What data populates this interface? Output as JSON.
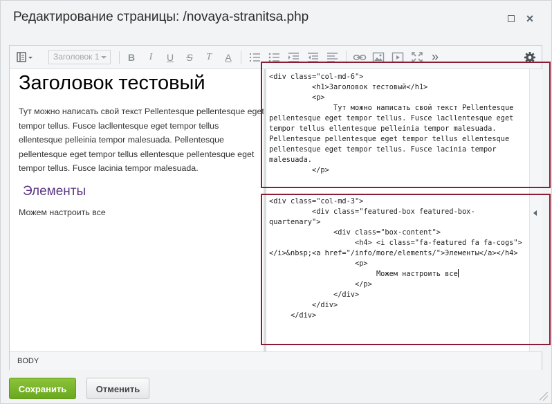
{
  "dialog": {
    "title": "Редактирование страницы: /novaya-stranitsa.php",
    "maximize_icon": "maximize-icon",
    "close_icon": "close-icon",
    "close_glyph": "×"
  },
  "toolbar": {
    "style_select_value": "Заголовок 1",
    "icons": [
      "view-mode-icon",
      "bold-icon",
      "italic-icon",
      "underline-icon",
      "strikethrough-icon",
      "clear-format-icon",
      "text-color-icon",
      "ordered-list-icon",
      "unordered-list-icon",
      "indent-icon",
      "outdent-icon",
      "align-icon",
      "link-icon",
      "image-icon",
      "video-icon",
      "fullscreen-icon",
      "more-icon",
      "settings-icon"
    ],
    "glyphs": {
      "bold": "B",
      "italic": "I",
      "underline": "U",
      "strike": "S",
      "clear": "T",
      "color": "A",
      "more": "»"
    }
  },
  "content": {
    "heading": "Заголовок тестовый",
    "paragraph": "Тут можно написать свой текст Pellentesque pellentesque eget tempor tellus. Fusce lacllentesque eget tempor tellus ellentesque pelleinia tempor malesuada. Pellentesque pellentesque eget tempor tellus ellentesque pellentesque eget tempor tellus. Fusce lacinia tempor malesuada.",
    "subheading": "Элементы",
    "paragraph2": "Можем настроить все"
  },
  "code": {
    "block1": "<div class=\"col-md-6\">\n          <h1>Заголовок тестовый</h1>\n          <p>\n               Тут можно написать свой текст Pellentesque pellentesque eget tempor tellus. Fusce lacllentesque eget tempor tellus ellentesque pelleinia tempor malesuada. Pellentesque pellentesque eget tempor tellus ellentesque pellentesque eget tempor tellus. Fusce lacinia tempor malesuada.\n          </p>",
    "block2": "<div class=\"col-md-3\">\n          <div class=\"featured-box featured-box-quartenary\">\n               <div class=\"box-content\">\n                    <h4> <i class=\"fa-featured fa fa-cogs\"></i>&nbsp;<a href=\"/info/more/elements/\">Элементы</a></h4>\n                    <p>\n                         Можем настроить все",
    "block2_tail": "\n                    </p>\n               </div>\n          </div>\n     </div>"
  },
  "status": {
    "path": "BODY"
  },
  "buttons": {
    "save": "Сохранить",
    "cancel": "Отменить"
  },
  "colors": {
    "highlight": "#8a1c34",
    "save_button": "#78b52a",
    "subheading": "#5a3781"
  }
}
